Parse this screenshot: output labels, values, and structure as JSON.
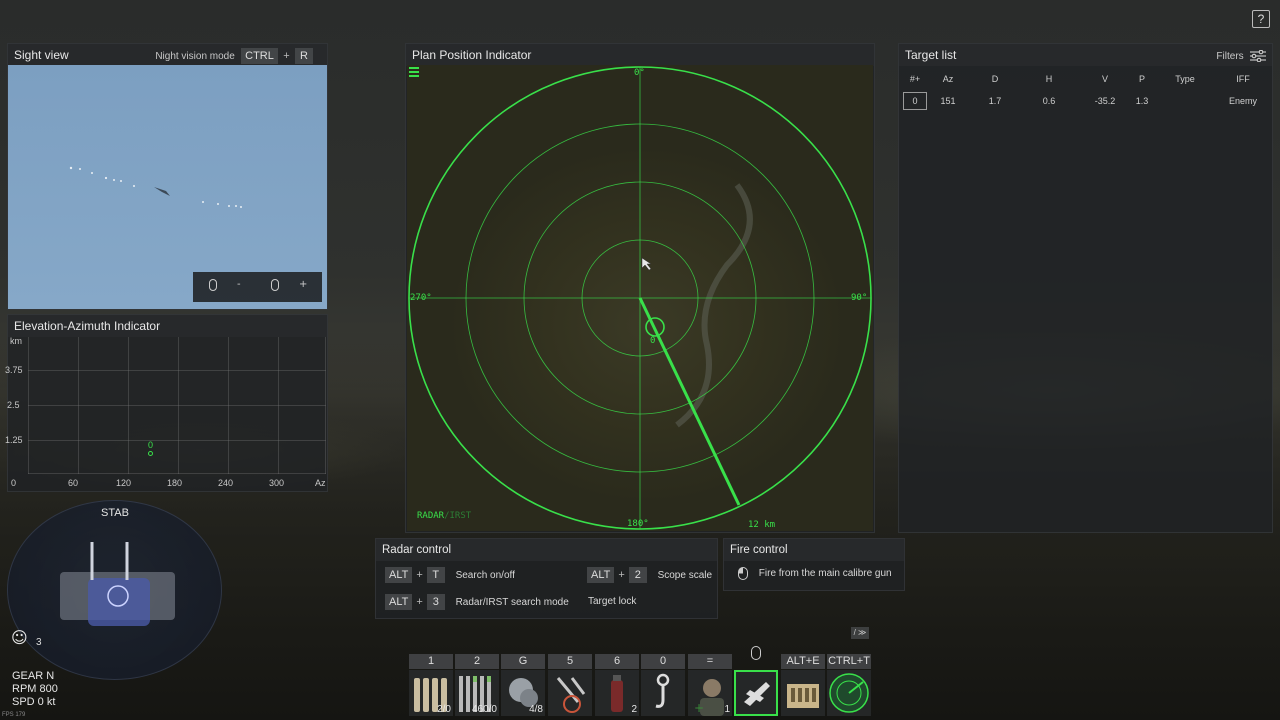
{
  "help_button": "?",
  "sight_view": {
    "title": "Sight view",
    "night_vision_label": "Night vision mode",
    "key1": "CTRL",
    "plus": "+",
    "key2": "R",
    "zoom_minus": "-",
    "zoom_plus": "+"
  },
  "eai": {
    "title": "Elevation-Azimuth Indicator",
    "y_unit": "km",
    "y_ticks": [
      "3.75",
      "2.5",
      "1.25"
    ],
    "x_ticks": [
      "0",
      "60",
      "120",
      "180",
      "240",
      "300"
    ],
    "x_unit": "Az",
    "target_label": "0"
  },
  "ppi": {
    "title": "Plan Position Indicator",
    "north": "0°",
    "east": "90°",
    "south": "180°",
    "west": "270°",
    "target_label": "0",
    "mode_active": "RADAR",
    "mode_sep": "/",
    "mode_inactive": "IRST",
    "range": "12 km",
    "green": "#39e04a"
  },
  "target_list": {
    "title": "Target list",
    "filters": "Filters",
    "columns": [
      "#+",
      "Az",
      "D",
      "H",
      "V",
      "P",
      "Type",
      "IFF"
    ],
    "rows": [
      {
        "id": "0",
        "az": "151",
        "d": "1.7",
        "h": "0.6",
        "v": "-35.2",
        "p": "1.3",
        "type": "",
        "iff": "Enemy"
      }
    ]
  },
  "radar_control": {
    "title": "Radar control",
    "items": [
      {
        "mod": "ALT",
        "key": "T",
        "label": "Search on/off"
      },
      {
        "mod": "ALT",
        "key": "2",
        "label": "Scope scale"
      },
      {
        "mod": "ALT",
        "key": "3",
        "label": "Radar/IRST search mode"
      },
      {
        "label": "Target lock"
      }
    ]
  },
  "fire_control": {
    "title": "Fire control",
    "label": "Fire from the main calibre gun"
  },
  "vehicle": {
    "stab": "STAB",
    "crew_count": "3",
    "gear": "GEAR N",
    "rpm": "RPM 800",
    "spd": "SPD 0 kt",
    "fps": "FPS 179"
  },
  "action_bar": {
    "collapse": "/ ≫",
    "slots": [
      {
        "key": "1",
        "count": "2/0",
        "icon": "shell-icon"
      },
      {
        "key": "2",
        "count": "460/0",
        "icon": "ammo-belt-icon"
      },
      {
        "key": "G",
        "count": "4/8",
        "icon": "smoke-grenade-icon"
      },
      {
        "key": "5",
        "count": "",
        "icon": "tools-icon"
      },
      {
        "key": "6",
        "count": "2",
        "icon": "extinguisher-icon"
      },
      {
        "key": "0",
        "count": "",
        "icon": "hook-icon"
      },
      {
        "key": "=",
        "count": "1",
        "icon": "crew-icon"
      },
      {
        "key": "",
        "count": "",
        "icon": "aircraft-icon"
      },
      {
        "key": "ALT+E",
        "count": "",
        "icon": "supply-box-icon"
      },
      {
        "key": "CTRL+T",
        "count": "",
        "icon": "radar-icon"
      }
    ]
  }
}
